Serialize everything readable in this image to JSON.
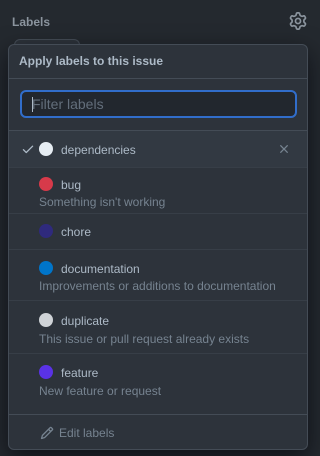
{
  "sidebar": {
    "title": "Labels",
    "gear_icon": "gear-icon"
  },
  "dropdown": {
    "header": "Apply labels to this issue",
    "filter": {
      "placeholder": "Filter labels",
      "value": ""
    },
    "labels": [
      {
        "name": "dependencies",
        "description": "",
        "color": "#e6edf3",
        "selected": true
      },
      {
        "name": "bug",
        "description": "Something isn't working",
        "color": "#d73a4a",
        "selected": false
      },
      {
        "name": "chore",
        "description": "",
        "color": "#2f2a7d",
        "selected": false
      },
      {
        "name": "documentation",
        "description": "Improvements or additions to documentation",
        "color": "#0075ca",
        "selected": false
      },
      {
        "name": "duplicate",
        "description": "This issue or pull request already exists",
        "color": "#cfd3d7",
        "selected": false
      },
      {
        "name": "feature",
        "description": "New feature or request",
        "color": "#5a32e6",
        "selected": false
      }
    ],
    "footer": {
      "edit_label": "Edit labels"
    }
  },
  "colors": {
    "background": "#24292f",
    "panel": "#2d333b",
    "border": "#444c56",
    "focus": "#316dca",
    "text": "#adbac7",
    "muted": "#768390"
  }
}
